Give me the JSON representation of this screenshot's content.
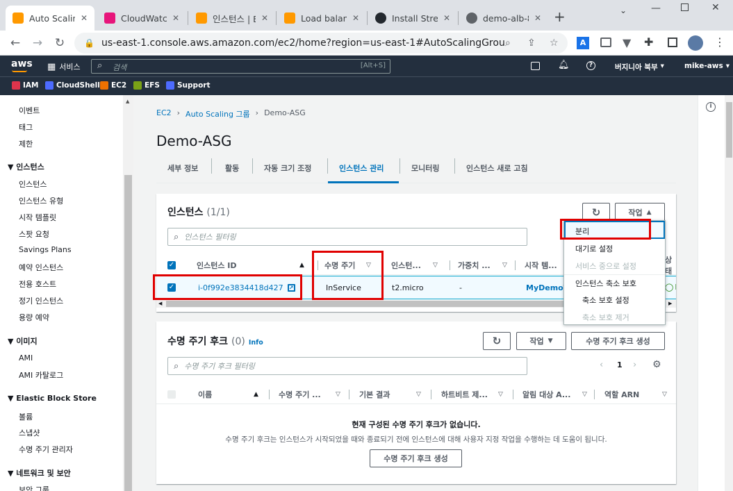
{
  "browser": {
    "tabs": [
      {
        "title": "Auto Scaling",
        "color": "#ff9900"
      },
      {
        "title": "CloudWatch",
        "color": "#e7157b"
      },
      {
        "title": "인스턴스 | E",
        "color": "#ff9900"
      },
      {
        "title": "Load balanc",
        "color": "#ff9900"
      },
      {
        "title": "Install Stress",
        "color": "#24292f"
      },
      {
        "title": "demo-alb-8",
        "color": "#5f6368"
      }
    ],
    "url": "us-east-1.console.aws.amazon.com/ec2/home?region=us-east-1#AutoScalingGroupDetai..."
  },
  "aws": {
    "logo": "aws",
    "services_label": "서비스",
    "search_placeholder": "검색",
    "search_shortcut": "[Alt+S]",
    "region": "버지니아 북부",
    "user": "mike-aws",
    "favorites": [
      "IAM",
      "CloudShell",
      "EC2",
      "EFS",
      "Support"
    ]
  },
  "sidebar": {
    "top_items": [
      "이벤트",
      "태그",
      "제한"
    ],
    "sections": [
      {
        "title": "인스턴스",
        "items": [
          "인스턴스",
          "인스턴스 유형",
          "시작 템플릿",
          "스팟 요청",
          "Savings Plans",
          "예약 인스턴스",
          "전용 호스트",
          "정기 인스턴스",
          "용량 예약"
        ]
      },
      {
        "title": "이미지",
        "items": [
          "AMI",
          "AMI 카탈로그"
        ]
      },
      {
        "title": "Elastic Block Store",
        "items": [
          "볼륨",
          "스냅샷",
          "수명 주기 관리자"
        ]
      },
      {
        "title": "네트워크 및 보안",
        "items": [
          "보안 그룹"
        ]
      }
    ]
  },
  "breadcrumb": [
    "EC2",
    "Auto Scaling 그룹",
    "Demo-ASG"
  ],
  "page_title": "Demo-ASG",
  "tabs": [
    "세부 정보",
    "활동",
    "자동 크기 조정",
    "인스턴스 관리",
    "모니터링",
    "인스턴스 새로 고침"
  ],
  "instances": {
    "title": "인스턴스",
    "count": "(1/1)",
    "filter_placeholder": "인스턴스 필터링",
    "actions_label": "작업",
    "columns": [
      "인스턴스 ID",
      "수명 주기",
      "인스턴...",
      "가중치 ...",
      "시작 템...",
      "상태"
    ],
    "row": {
      "id": "i-0f992e3834418d427",
      "lifecycle": "InService",
      "type": "t2.micro",
      "weight": "-",
      "template": "MyDemoTe",
      "health": "H"
    },
    "dropdown": [
      {
        "label": "분리",
        "disabled": false,
        "indent": false
      },
      {
        "label": "대기로 설정",
        "disabled": false,
        "indent": false
      },
      {
        "label": "서비스 중으로 설정",
        "disabled": true,
        "indent": false
      },
      {
        "label": "인스턴스 축소 보호",
        "disabled": false,
        "indent": false
      },
      {
        "label": "축소 보호 설정",
        "disabled": false,
        "indent": true
      },
      {
        "label": "축소 보호 제거",
        "disabled": true,
        "indent": true
      }
    ]
  },
  "hooks": {
    "title": "수명 주기 후크",
    "count": "(0)",
    "info": "Info",
    "actions_label": "작업",
    "create_label": "수명 주기 후크 생성",
    "filter_placeholder": "수명 주기 후크 필터링",
    "page": "1",
    "columns": [
      "이름",
      "수명 주기 ...",
      "기본 결과",
      "하트비트 제...",
      "알림 대상 A...",
      "역할 ARN"
    ],
    "empty_title": "현재 구성된 수명 주기 후크가 없습니다.",
    "empty_desc": "수명 주기 후크는 인스턴스가 시작되었을 때와 종료되기 전에 인스턴스에 대해 사용자 지정 작업을 수행하는 데 도움이 됩니다.",
    "empty_button": "수명 주기 후크 생성"
  },
  "colors": {
    "aws_navy": "#232f3e",
    "link": "#0073bb",
    "highlight_red": "#e00000",
    "aws_orange": "#ff9900"
  }
}
